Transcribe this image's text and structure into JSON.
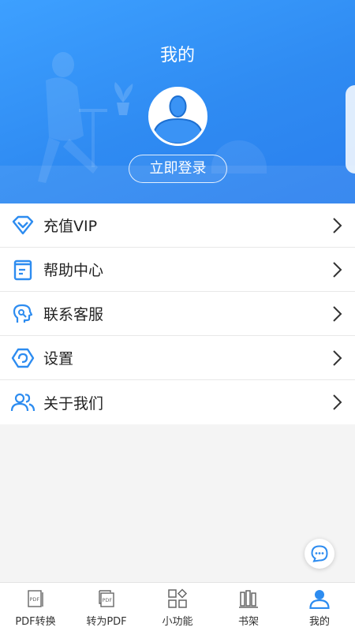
{
  "header": {
    "title": "我的",
    "login_label": "立即登录"
  },
  "menu": {
    "items": [
      {
        "label": "充值VIP",
        "icon": "diamond-icon"
      },
      {
        "label": "帮助中心",
        "icon": "help-book-icon"
      },
      {
        "label": "联系客服",
        "icon": "customer-service-icon"
      },
      {
        "label": "设置",
        "icon": "settings-gear-icon"
      },
      {
        "label": "关于我们",
        "icon": "users-icon"
      }
    ]
  },
  "tabbar": {
    "tabs": [
      {
        "label": "PDF转换",
        "icon": "pdf-file-icon",
        "active": false
      },
      {
        "label": "转为PDF",
        "icon": "to-pdf-icon",
        "active": false
      },
      {
        "label": "小功能",
        "icon": "apps-grid-icon",
        "active": false
      },
      {
        "label": "书架",
        "icon": "bookshelf-icon",
        "active": false
      },
      {
        "label": "我的",
        "icon": "user-profile-icon",
        "active": true
      }
    ]
  },
  "colors": {
    "accent": "#2d8cf0",
    "header_bg": "#3496fa"
  }
}
